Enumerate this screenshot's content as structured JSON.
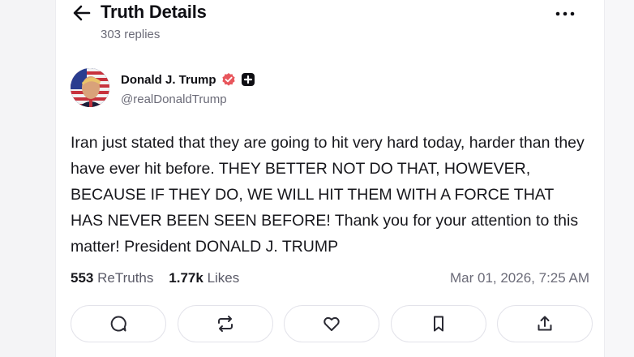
{
  "header": {
    "title": "Truth Details",
    "replies": "303 replies"
  },
  "post": {
    "author": {
      "display_name": "Donald J. Trump",
      "handle": "@realDonaldTrump"
    },
    "text": "Iran just stated that they are going to hit very hard today, harder than they have ever hit before. THEY BETTER NOT DO THAT, HOWEVER, BECAUSE IF THEY DO, WE WILL HIT THEM WITH A FORCE THAT HAS NEVER BEEN SEEN BEFORE! Thank you for your attention to this matter! President DONALD J. TRUMP",
    "stats": {
      "retruths_count": "553",
      "retruths_label": "ReTruths",
      "likes_count": "1.77k",
      "likes_label": "Likes"
    },
    "timestamp": "Mar 01, 2026, 7:25 AM"
  },
  "actions": [
    "reply-icon",
    "retruth-icon",
    "like-icon",
    "bookmark-icon",
    "share-icon"
  ],
  "colors": {
    "verified_badge": "#e8565c",
    "text_primary": "#0f0f14",
    "text_secondary": "#6b6b78",
    "button_border": "#e3e3ea"
  }
}
